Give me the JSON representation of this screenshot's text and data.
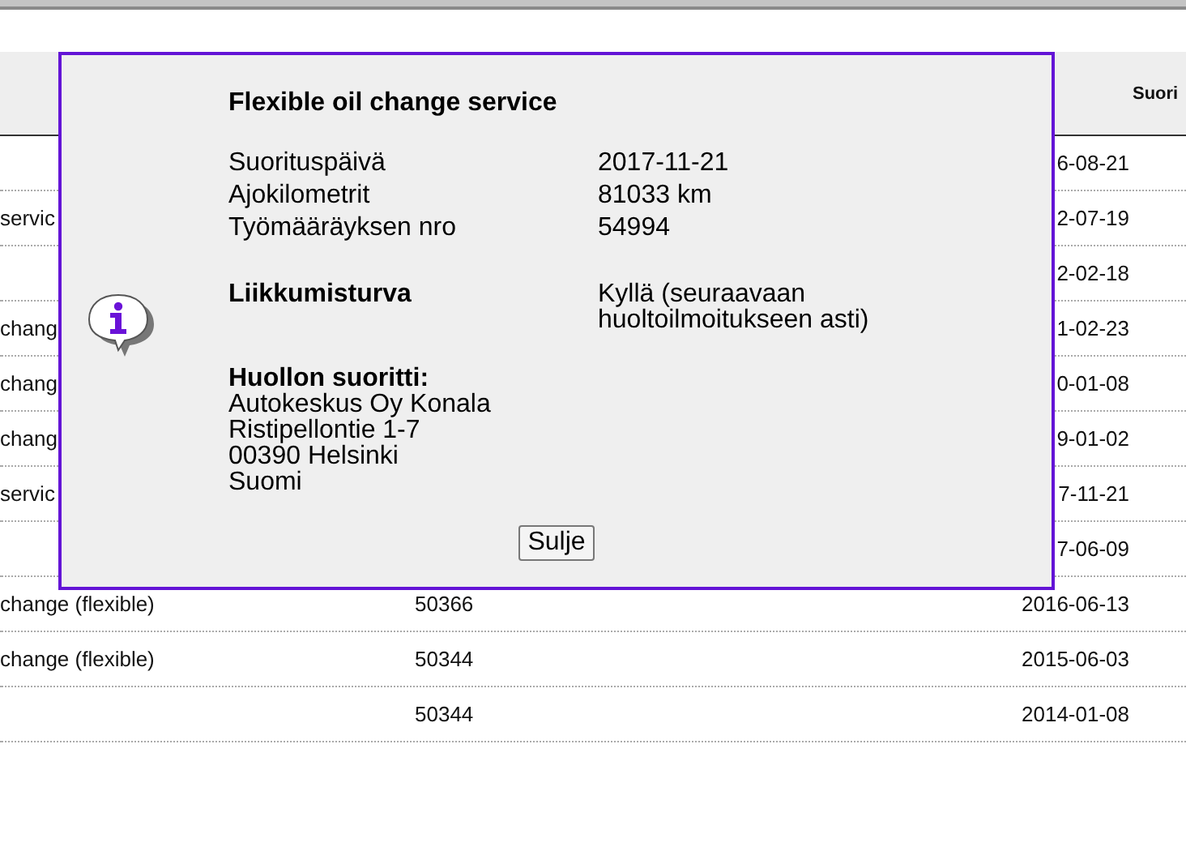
{
  "table": {
    "header": {
      "column_4": "Suori"
    },
    "rows": [
      {
        "column_3": "6-08-21"
      },
      {
        "column_1": "servic",
        "column_3": "2-07-19"
      },
      {
        "column_3": "2-02-18"
      },
      {
        "column_1": "chang",
        "column_3": "1-02-23"
      },
      {
        "column_1": "chang",
        "column_3": "0-01-08"
      },
      {
        "column_1": "chang",
        "column_3": "9-01-02"
      },
      {
        "column_1": "servic",
        "column_3": "7-11-21"
      },
      {
        "column_3": "7-06-09"
      },
      {
        "column_1": "change (flexible)",
        "column_2": "50366",
        "column_3": "2016-06-13"
      },
      {
        "column_1": "change (flexible)",
        "column_2": "50344",
        "column_3": "2015-06-03"
      },
      {
        "column_2": "50344",
        "column_3": "2014-01-08"
      }
    ]
  },
  "dialog": {
    "title": "Flexible oil change service",
    "fields": [
      {
        "label": "Suorituspäivä",
        "value": "2017-11-21"
      },
      {
        "label": "Ajokilometrit",
        "value": "81033 km"
      },
      {
        "label": "Työmääräyksen nro",
        "value": "54994"
      }
    ],
    "roadside_assistance": {
      "label": "Liikkumisturva",
      "value": "Kyllä (seuraavaan huoltoilmoitukseen asti)"
    },
    "provider": {
      "heading": "Huollon suoritti:",
      "lines": [
        "Autokeskus Oy Konala",
        "Ristipellontie 1-7",
        "00390 Helsinki",
        "Suomi"
      ]
    },
    "close_button": "Sulje"
  }
}
